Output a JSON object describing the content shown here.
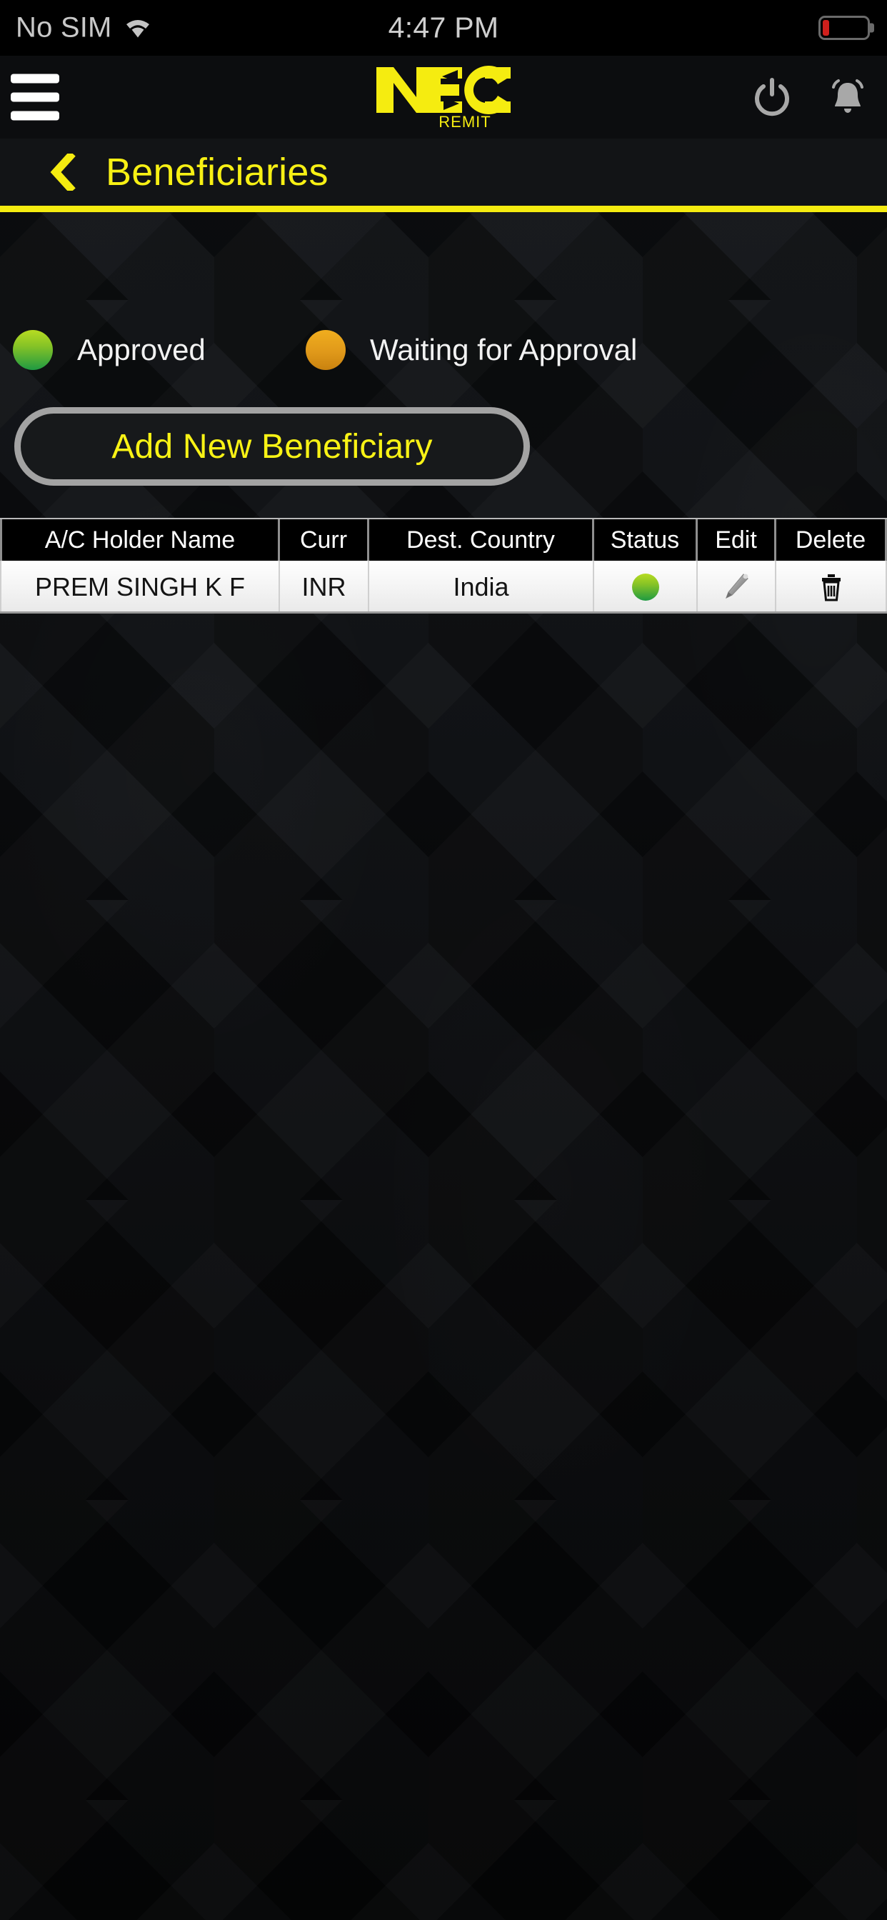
{
  "status_bar": {
    "carrier": "No SIM",
    "wifi_icon": "wifi-icon",
    "time": "4:47 PM",
    "battery_icon": "battery-low-icon",
    "battery_level_percent": 13
  },
  "app_bar": {
    "menu_icon": "hamburger-menu-icon",
    "logo_text": "NEC",
    "logo_subtext": "REMIT",
    "power_icon": "power-icon",
    "notifications_icon": "bell-icon"
  },
  "title_bar": {
    "back_icon": "back-chevron-icon",
    "title": "Beneficiaries",
    "accent_color": "#f5ec10"
  },
  "legend": [
    {
      "id": "approved",
      "label": "Approved",
      "dot_icon": "status-dot-green",
      "color": "#7cc127"
    },
    {
      "id": "waiting",
      "label": "Waiting for Approval",
      "dot_icon": "status-dot-orange",
      "color": "#e0991a"
    }
  ],
  "actions": {
    "add_beneficiary_label": "Add New Beneficiary"
  },
  "table": {
    "columns": [
      "A/C Holder Name",
      "Curr",
      "Dest. Country",
      "Status",
      "Edit",
      "Delete"
    ],
    "rows": [
      {
        "name": "PREM SINGH K F",
        "currency": "INR",
        "country": "India",
        "status": "approved",
        "status_icon": "status-dot-green",
        "edit_icon": "pencil-icon",
        "delete_icon": "trash-icon"
      }
    ]
  }
}
